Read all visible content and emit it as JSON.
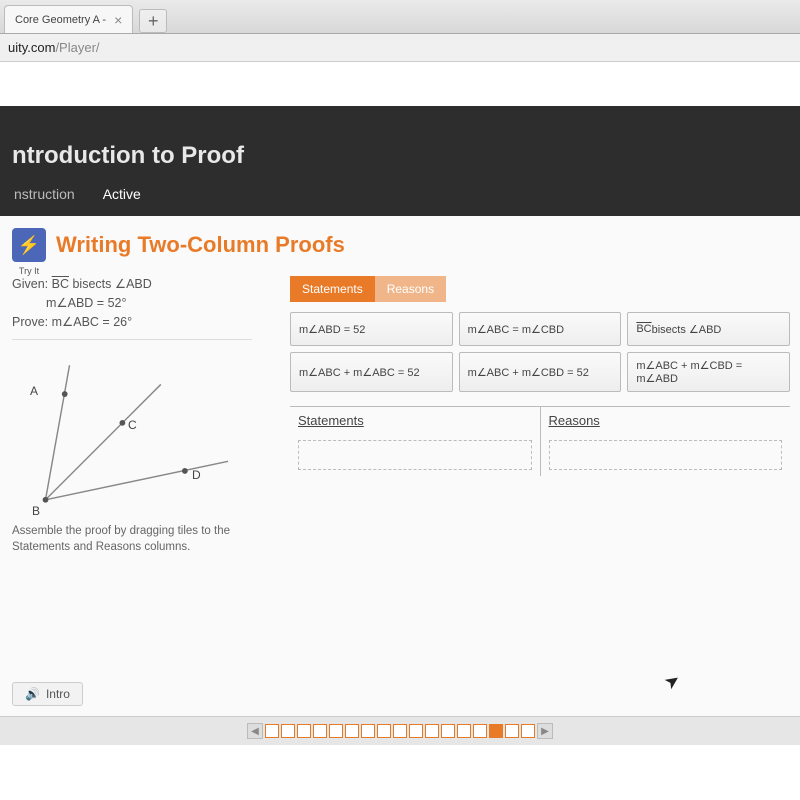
{
  "browser": {
    "tab_title": "Core Geometry A - ",
    "close_glyph": "×",
    "add_glyph": "+",
    "url_prefix": "",
    "url_domain": "uity.com",
    "url_path": "/Player/"
  },
  "header": {
    "title": "ntroduction to Proof",
    "tabs": {
      "instruction": "nstruction",
      "active": "Active"
    }
  },
  "section": {
    "tryit_glyph": "⚡",
    "tryit_label": "Try It",
    "title": "Writing Two-Column Proofs"
  },
  "problem": {
    "given_label": "Given:",
    "given_text_prefix": "BC",
    "given_text_suffix": " bisects ",
    "given_angle": "ABD",
    "given_measure": "m∠ABD = 52°",
    "prove_label": "Prove:",
    "prove_text": "m∠ABC = 26°",
    "instructions": "Assemble the proof by dragging tiles to the Statements and Reasons columns.",
    "points": {
      "A": "A",
      "B": "B",
      "C": "C",
      "D": "D"
    }
  },
  "toggle": {
    "statements": "Statements",
    "reasons": "Reasons"
  },
  "tiles": [
    "m∠ABD = 52",
    "m∠ABC = m∠CBD",
    "BC bisects ∠ABD",
    "m∠ABC + m∠ABC = 52",
    "m∠ABC + m∠CBD = 52",
    "m∠ABC + m∠CBD = m∠ABD"
  ],
  "tiles_has_overbar": [
    false,
    false,
    true,
    false,
    false,
    false
  ],
  "table": {
    "statements_header": "Statements",
    "reasons_header": "Reasons"
  },
  "footer": {
    "intro_label": "Intro",
    "speaker_glyph": "🔊",
    "cursor_glyph": "➤",
    "prev_glyph": "◀",
    "next_glyph": "▶",
    "page_count": 17,
    "current_page": 15
  }
}
